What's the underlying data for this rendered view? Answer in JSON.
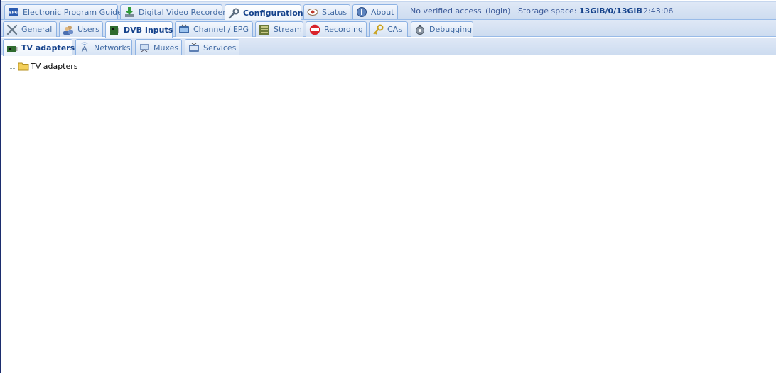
{
  "top_tabs": [
    {
      "label": "Electronic Program Guide",
      "icon": "epg-icon"
    },
    {
      "label": "Digital Video Recorder",
      "icon": "dvr-download-icon"
    },
    {
      "label": "Configuration",
      "icon": "wrench-icon",
      "active": true
    },
    {
      "label": "Status",
      "icon": "eye-icon"
    },
    {
      "label": "About",
      "icon": "info-icon"
    }
  ],
  "status_bar": {
    "access": "No verified access",
    "login": "(login)",
    "storage_label": "Storage space:",
    "storage_value": "13GiB/0/13GiB",
    "time": "22:43:06"
  },
  "config_tabs": [
    {
      "label": "General",
      "icon": "tools-icon"
    },
    {
      "label": "Users",
      "icon": "users-icon"
    },
    {
      "label": "DVB Inputs",
      "icon": "dvb-card-icon",
      "active": true
    },
    {
      "label": "Channel / EPG",
      "icon": "tv-icon"
    },
    {
      "label": "Stream",
      "icon": "stream-icon"
    },
    {
      "label": "Recording",
      "icon": "rec-icon"
    },
    {
      "label": "CAs",
      "icon": "key-icon"
    },
    {
      "label": "Debugging",
      "icon": "debug-icon"
    }
  ],
  "dvb_tabs": [
    {
      "label": "TV adapters",
      "icon": "tv-adapter-icon",
      "active": true
    },
    {
      "label": "Networks",
      "icon": "antenna-icon"
    },
    {
      "label": "Muxes",
      "icon": "mux-icon"
    },
    {
      "label": "Services",
      "icon": "services-icon"
    }
  ],
  "tree": {
    "root_label": "TV adapters",
    "icon": "folder-icon"
  },
  "colors": {
    "accent": "#15428b",
    "tab_border": "#8db2e3",
    "bar_bg": "#dfe8f6",
    "rec_red": "#d9222a"
  }
}
